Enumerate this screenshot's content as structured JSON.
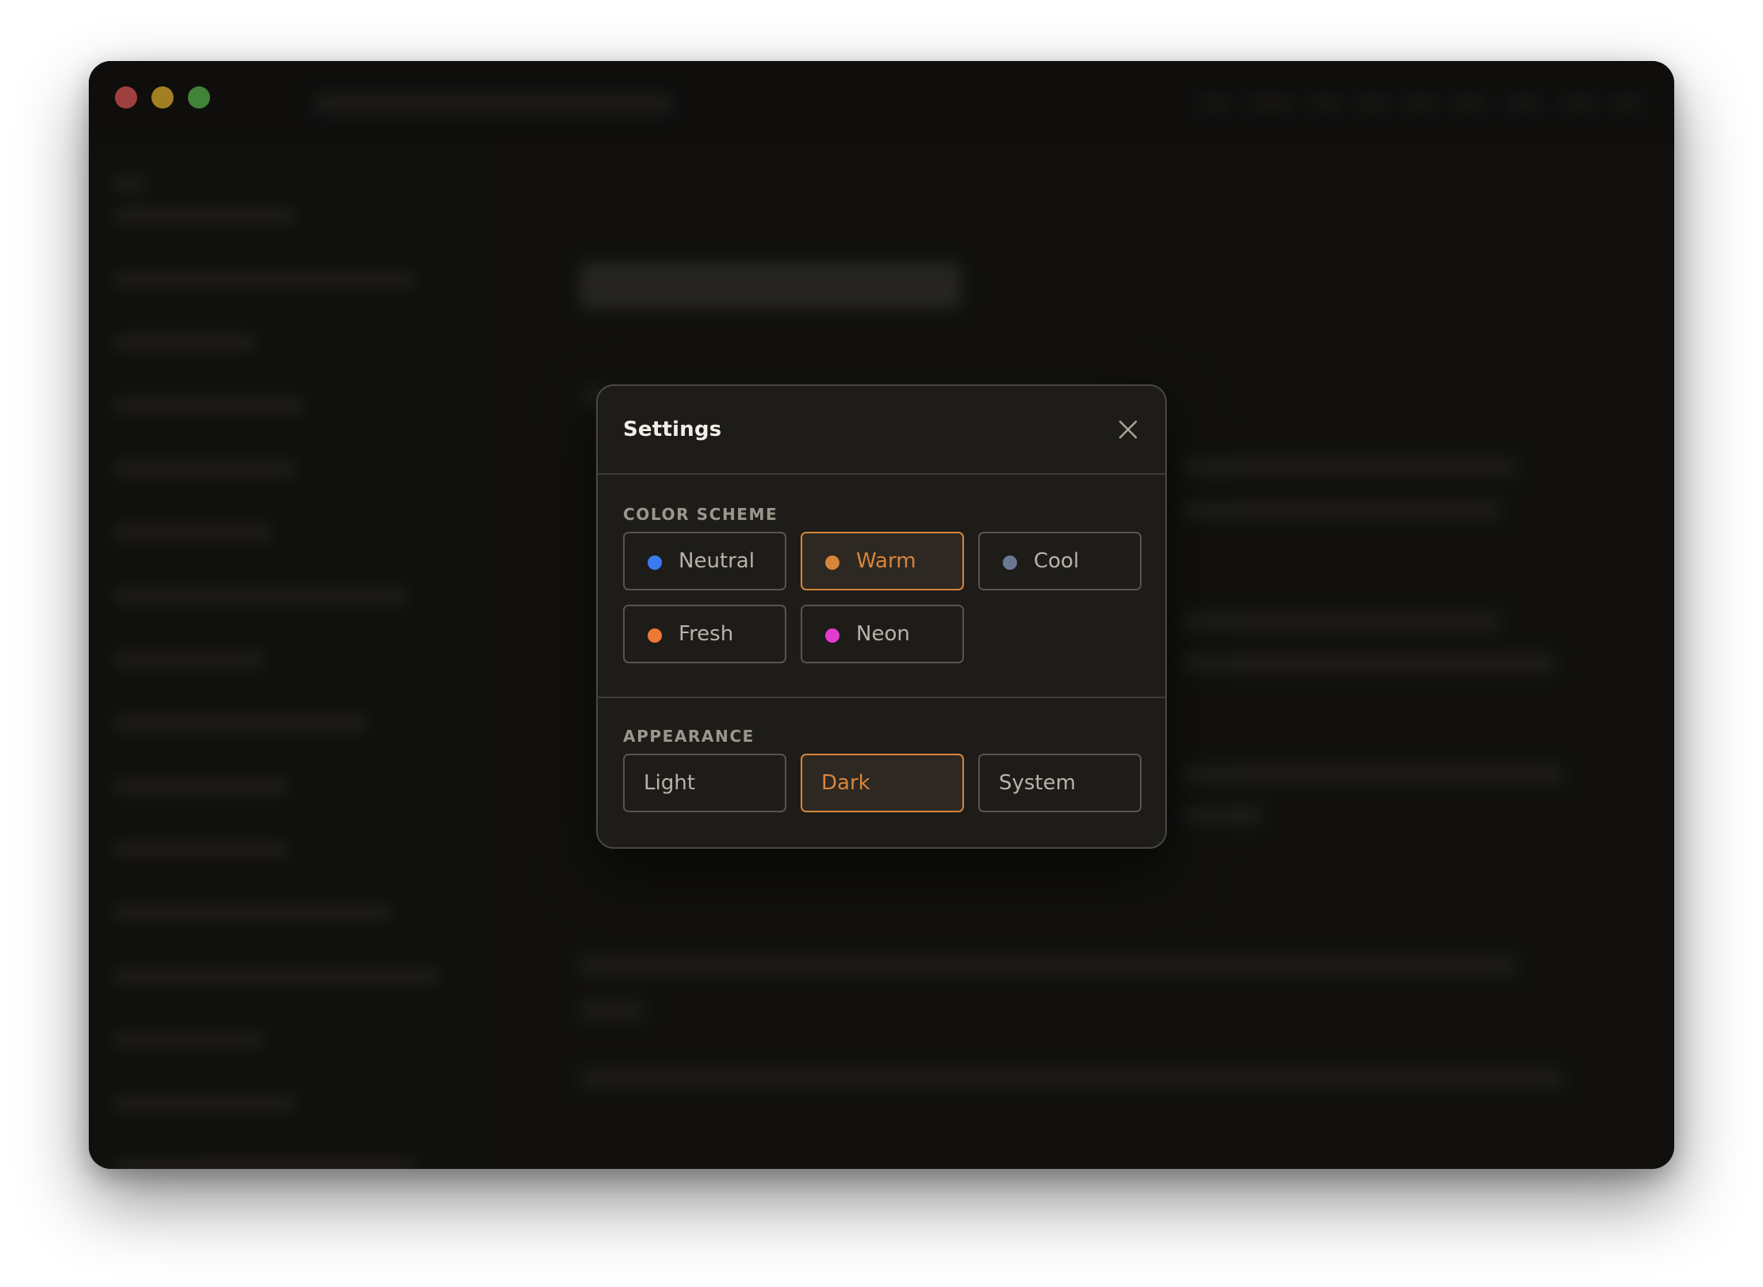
{
  "window": {
    "controls": [
      "close",
      "minimize",
      "maximize"
    ]
  },
  "settings_dialog": {
    "title": "Settings",
    "close_icon": "close-icon",
    "color_scheme": {
      "heading": "COLOR SCHEME",
      "selected": "Warm",
      "options": [
        {
          "label": "Neutral",
          "color": "#3b7bf2"
        },
        {
          "label": "Warm",
          "color": "#d7853a"
        },
        {
          "label": "Cool",
          "color": "#6a7894"
        },
        {
          "label": "Fresh",
          "color": "#ee7836"
        },
        {
          "label": "Neon",
          "color": "#e23ccf"
        }
      ]
    },
    "appearance": {
      "heading": "APPEARANCE",
      "selected": "Dark",
      "options": [
        {
          "label": "Light"
        },
        {
          "label": "Dark"
        },
        {
          "label": "System"
        }
      ]
    }
  },
  "colors": {
    "accent": "#d7853a",
    "modal_bg": "#1d1c19",
    "window_bg": "#161512"
  }
}
